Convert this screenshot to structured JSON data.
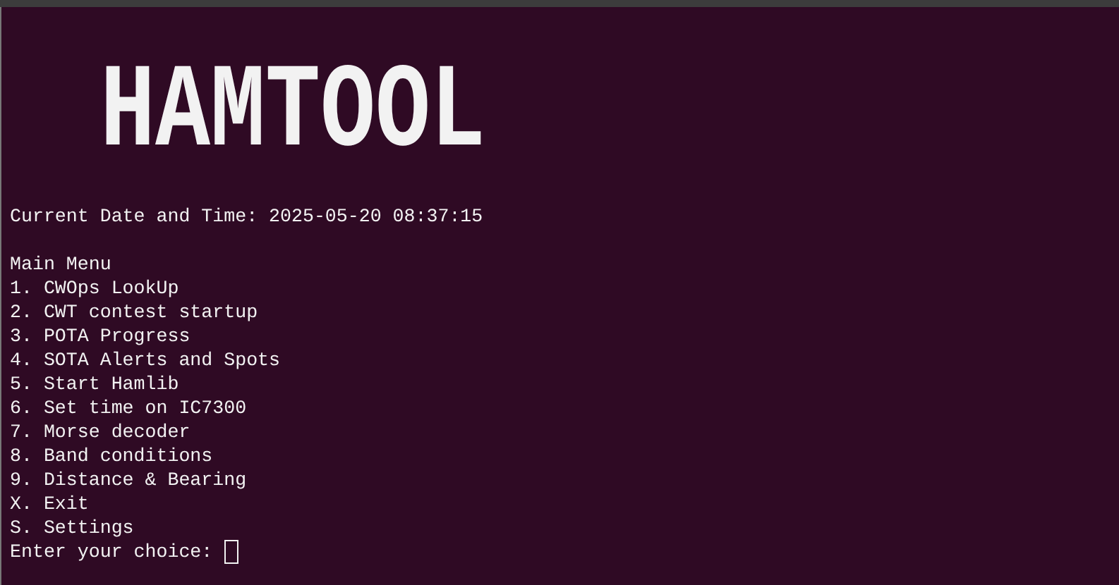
{
  "banner": "HAMTOOL",
  "datetime": "Current Date and Time: 2025-05-20 08:37:15",
  "menu": {
    "heading": "Main Menu",
    "items": [
      "1. CWOps LookUp",
      "2. CWT contest startup",
      "3. POTA Progress",
      "4. SOTA Alerts and Spots",
      "5. Start Hamlib",
      "6. Set time on IC7300",
      "7. Morse decoder",
      "8. Band conditions",
      "9. Distance & Bearing",
      "X. Exit",
      "S. Settings"
    ]
  },
  "prompt": "Enter your choice:"
}
